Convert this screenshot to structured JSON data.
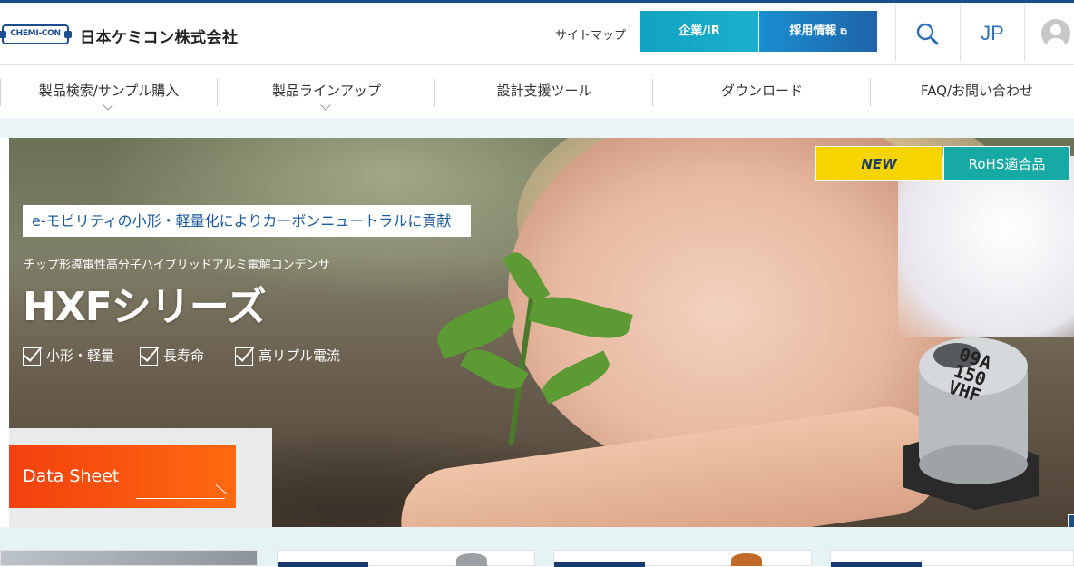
{
  "header": {
    "logo_text": "CHEMI-CON",
    "company_name": "日本ケミコン株式会社",
    "sitemap_label": "サイトマップ",
    "corporate_label": "企業/IR",
    "recruit_label": "採用情報",
    "language_label": "JP"
  },
  "nav": {
    "items": [
      {
        "label": "製品検索/サンプル購入"
      },
      {
        "label": "製品ラインアップ"
      },
      {
        "label": "設計支援ツール"
      },
      {
        "label": "ダウンロード"
      },
      {
        "label": "FAQ/お問い合わせ"
      }
    ]
  },
  "hero": {
    "badge_new": "NEW",
    "badge_rohs": "RoHS適合品",
    "tagline": "e-モビリティの小形・軽量化によりカーボンニュートラルに貢献",
    "subtitle": "チップ形導電性高分子ハイブリッドアルミ電解コンデンサ",
    "series_title": "HXFシリーズ",
    "features": [
      "小形・軽量",
      "長寿命",
      "高リプル電流"
    ],
    "datasheet_label": "Data Sheet",
    "capacitor_marking": [
      "09A",
      "150",
      "VHF"
    ]
  },
  "colors": {
    "brand_blue": "#1b4e8c",
    "teal": "#17a9a3",
    "new_yellow": "#f6d400",
    "datasheet_orange": "#f2400e"
  }
}
